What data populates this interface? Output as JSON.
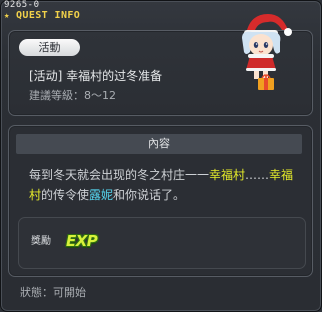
{
  "window": {
    "quest_id": "9265-0",
    "title": "QUEST INFO"
  },
  "quest": {
    "tag": "活動",
    "name": "[活动] 幸福村的过冬准备",
    "level_label": "建議等級：",
    "level_range": "8～12"
  },
  "content": {
    "header": "內容",
    "description": [
      {
        "text": "每到冬天就会出现的冬之村庄一一",
        "style": "plain"
      },
      {
        "text": "幸福村",
        "style": "yellow"
      },
      {
        "text": "……",
        "style": "plain"
      },
      {
        "text": "幸福村",
        "style": "yellow"
      },
      {
        "text": "的传令使",
        "style": "plain"
      },
      {
        "text": "露妮",
        "style": "cyan"
      },
      {
        "text": "和你说话了。",
        "style": "plain"
      }
    ],
    "reward_label": "獎勵",
    "reward_exp": "EXP"
  },
  "status": {
    "label": "狀態：",
    "value": "可開始"
  },
  "colors": {
    "window_bg": "#2b2f35",
    "title_yellow": "#f2d24a",
    "highlight_yellow": "#e4ea2a",
    "highlight_cyan": "#56d6f0",
    "exp_green": "#d7f23a"
  }
}
